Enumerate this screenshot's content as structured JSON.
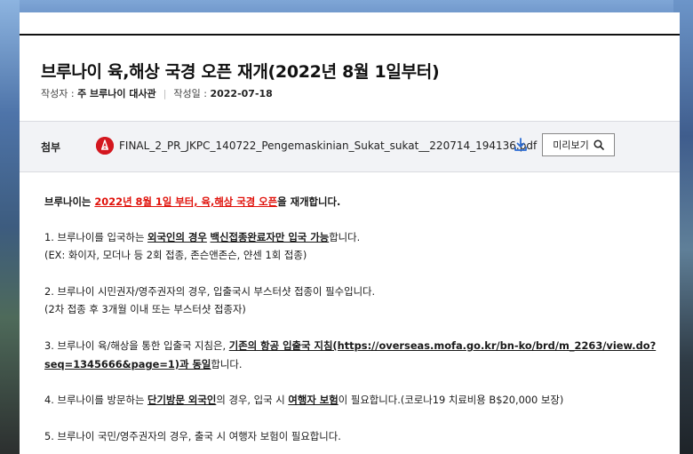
{
  "post": {
    "title": "브루나이 육,해상 국경 오픈 재개(2022년 8월 1일부터)",
    "author_label": "작성자 : ",
    "author": "주 브루나이 대사관",
    "date_label": "작성일 : ",
    "date": "2022-07-18"
  },
  "attachment": {
    "label": "첨부",
    "file_name": "FINAL_2_PR_JKPC_140722_Pengemaskinian_Sukat_sukat__220714_194136.pdf",
    "preview_label": "미리보기",
    "pdf_icon_glyph": "⋏"
  },
  "body": {
    "intro_prefix": "브루나이는 ",
    "intro_highlight": "2022년 8월 1일 부터, 육,해상 국경 오픈",
    "intro_suffix": "을 재개합니다.",
    "p1_prefix": "1. 브루나이를 입국하는 ",
    "p1_u1": "외국인의 경우",
    "p1_mid": " ",
    "p1_u2": "백신접종완료자만 입국 가능",
    "p1_suffix": "합니다.",
    "p1_note": " (EX: 화이자, 모더나 등 2회 접종, 존슨앤존슨, 얀센 1회 접종)",
    "p2": "2. 브루나이 시민권자/영주권자의 경우, 입출국시 부스터샷 접종이 필수입니다.",
    "p2_note": "(2차 접종 후 3개월 이내 또는 부스터샷 접종자)",
    "p3_prefix": "3. 브루나이 육/해상을 통한 입출국 지침은, ",
    "p3_link1": "기존의 항공 입출국 지침(https://overseas.mofa.go.kr/bn-ko/brd/m_2263/view.do?",
    "p3_link2": "seq=1345666&page=1)과 동일",
    "p3_suffix": "합니다.",
    "p4_prefix": "4. 브루나이를 방문하는 ",
    "p4_u1": "단기방문 외국인",
    "p4_mid": "의 경우, 입국 시 ",
    "p4_u2": "여행자 보험",
    "p4_suffix": "이 필요합니다.(코로나19 치료비용 B$20,000 보장)",
    "p5": "5. 브루나이 국민/영주권자의 경우, 출국 시 여행자 보험이 필요합니다."
  },
  "colors": {
    "highlight_red": "#e0110a",
    "pdf_red": "#d4171f",
    "download_blue": "#2b6cd3",
    "attach_bg": "#f2f3f6"
  }
}
